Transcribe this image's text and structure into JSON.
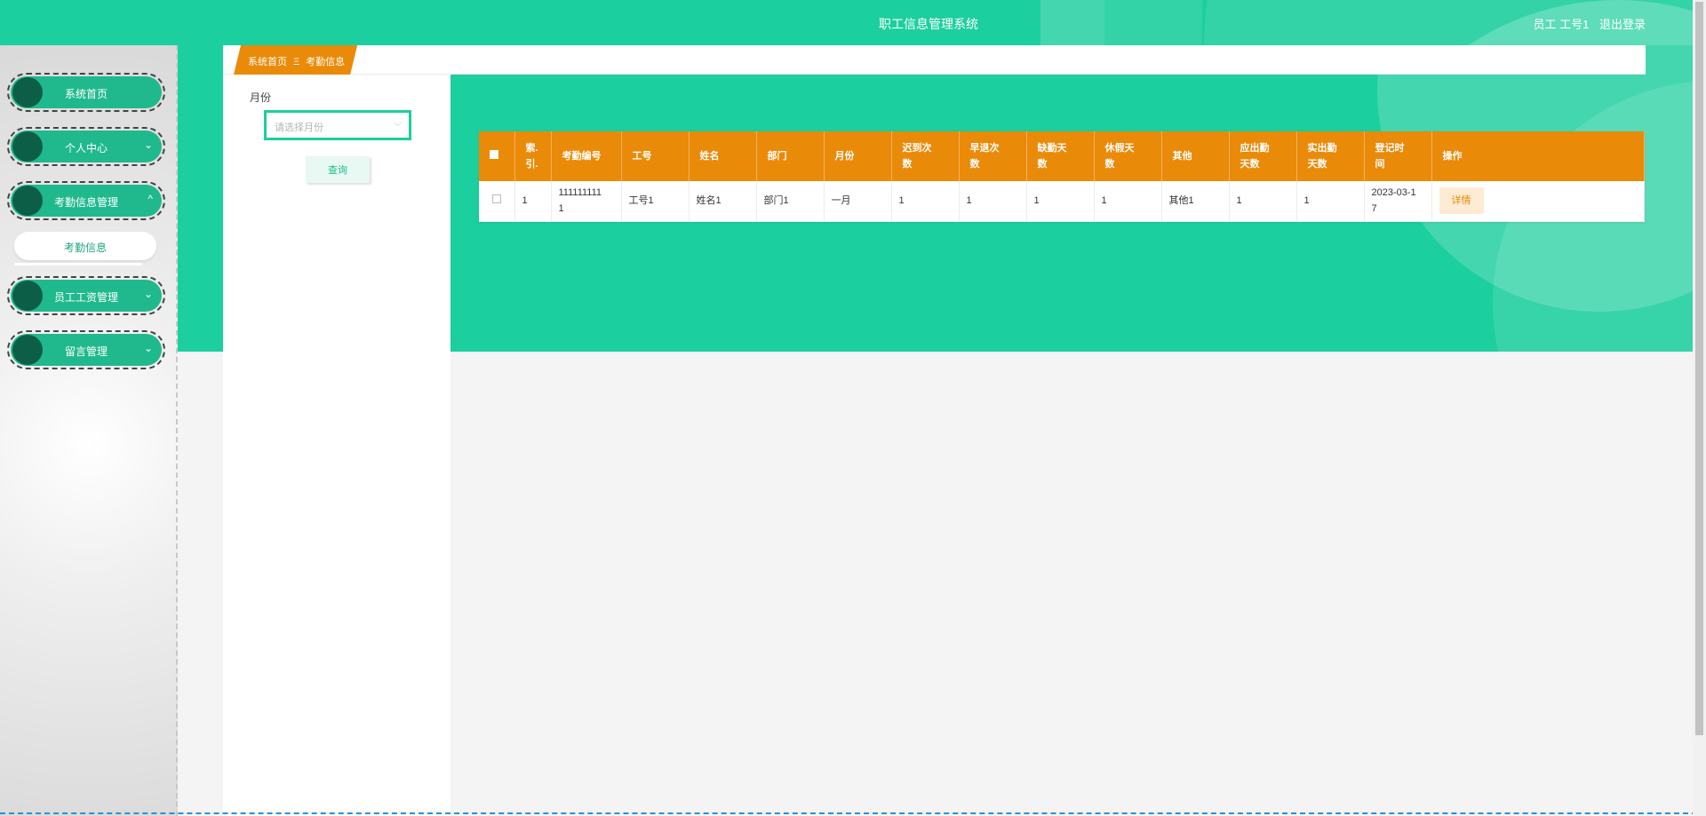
{
  "header": {
    "app_title": "职工信息管理系统",
    "user_label": "员工 工号1",
    "logout_label": "退出登录"
  },
  "sidebar": {
    "items": [
      {
        "label": "系统首页",
        "has_arrow": false
      },
      {
        "label": "个人中心",
        "has_arrow": true,
        "arrow": "⌄"
      },
      {
        "label": "考勤信息管理",
        "has_arrow": true,
        "arrow": "^"
      },
      {
        "label": "员工工资管理",
        "has_arrow": true,
        "arrow": "⌄"
      },
      {
        "label": "留言管理",
        "has_arrow": true,
        "arrow": "⌄"
      }
    ],
    "submenu_active": "考勤信息"
  },
  "breadcrumb": {
    "home": "系统首页",
    "separator": "Ξ",
    "current": "考勤信息"
  },
  "search": {
    "month_label": "月份",
    "month_placeholder": "请选择月份",
    "query_button": "查询"
  },
  "table": {
    "columns": [
      "索引",
      "考勤编号",
      "工号",
      "姓名",
      "部门",
      "月份",
      "迟到次数",
      "早退次数",
      "缺勤天数",
      "休假天数",
      "其他",
      "应出勤天数",
      "实出勤天数",
      "登记时间",
      "操作"
    ],
    "column_display": [
      [
        "索.",
        "引."
      ],
      [
        "考勤编号"
      ],
      [
        "工号"
      ],
      [
        "姓名"
      ],
      [
        "部门"
      ],
      [
        "月份"
      ],
      [
        "迟到次",
        "数"
      ],
      [
        "早退次",
        "数"
      ],
      [
        "缺勤天",
        "数"
      ],
      [
        "休假天",
        "数"
      ],
      [
        "其他"
      ],
      [
        "应出勤",
        "天数"
      ],
      [
        "实出勤",
        "天数"
      ],
      [
        "登记时",
        "间"
      ],
      [
        "操作"
      ]
    ],
    "rows": [
      {
        "index": "1",
        "attendance_no": [
          "111111111",
          "1"
        ],
        "employee_no": "工号1",
        "name": "姓名1",
        "department": "部门1",
        "month": "一月",
        "late": "1",
        "early_leave": "1",
        "absence_days": "1",
        "leave_days": "1",
        "other": "其他1",
        "required_days": "1",
        "actual_days": "1",
        "register_time": [
          "2023-03-1",
          "7"
        ],
        "action": "详情"
      }
    ]
  },
  "colors": {
    "primary_green": "#1ccf9e",
    "menu_green": "#20b98d",
    "accent_orange": "#ea8a09"
  },
  "icons": {
    "menu_dot": "circle-icon",
    "expand": "chevron-down-icon",
    "collapse": "chevron-up-icon",
    "select_arrow": "chevron-down-icon",
    "checkbox": "checkbox-icon"
  }
}
